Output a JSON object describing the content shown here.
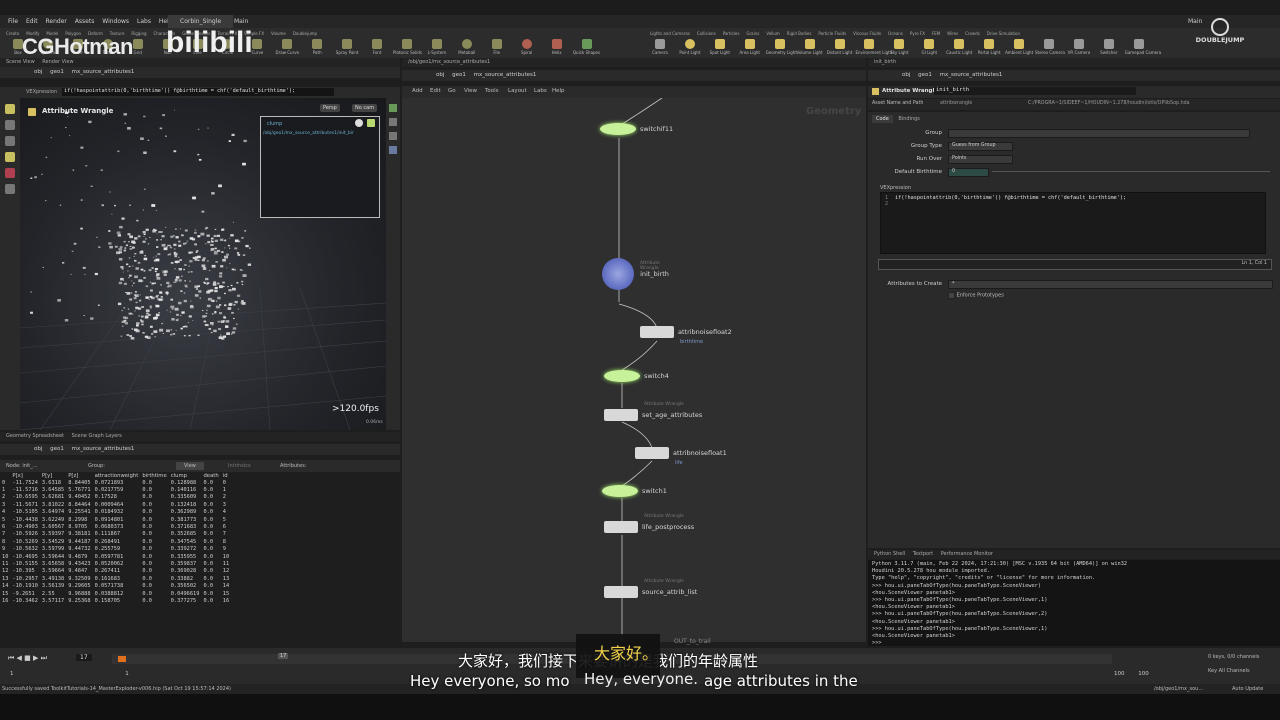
{
  "window": {
    "menu": [
      "File",
      "Edit",
      "Render",
      "Assets",
      "Windows",
      "Labs",
      "Help"
    ],
    "desktop": "Corbin_Single",
    "main_tab": "Main",
    "right_tab": "Main"
  },
  "watermark": {
    "left": "CGHotman",
    "right": "DOUBLEJUMP"
  },
  "shelf": {
    "tabs_left": [
      "Create",
      "Modify",
      "Model",
      "Polygon",
      "Deform",
      "Texture",
      "Rigging",
      "Characters",
      "Guide Process",
      "Terrain FX",
      "Simple FX",
      "Volume",
      "Doublejump"
    ],
    "tools_left": [
      "Box",
      "Sphere",
      "Tube",
      "Torus",
      "Grid",
      "Null",
      "Line",
      "Circle",
      "Curve",
      "Draw Curve",
      "Path",
      "Spray Paint",
      "Font",
      "Platonic Solids",
      "L-System",
      "Metaball",
      "File",
      "Spiral",
      "Helix",
      "Quick Shapes"
    ],
    "tabs_right": [
      "Lights and Cameras",
      "Collisions",
      "Particles",
      "Grains",
      "Vellum",
      "Rigid Bodies",
      "Particle Fluids",
      "Viscous Fluids",
      "Oceans",
      "Pyro FX",
      "FEM",
      "Wires",
      "Crowds",
      "Drive Simulation"
    ],
    "tools_right": [
      "Camera",
      "Point Light",
      "Spot Light",
      "Area Light",
      "Geometry Light",
      "Volume Light",
      "Distant Light",
      "Environment Light",
      "Sky Light",
      "GI Light",
      "Caustic Light",
      "Portal Light",
      "Ambient Light",
      "Stereo Camera",
      "VR Camera",
      "Switcher",
      "Gamepad Camera"
    ]
  },
  "viewer": {
    "tabs": [
      "Scene View",
      "Render View"
    ],
    "path": [
      "obj",
      "geo1",
      "mx_source_attributes1"
    ],
    "vex_label": "VEXpression",
    "vex_code": "if(!haspointattrib(0,'birthtime')) f@birthtime = chf('default_birthtime');",
    "persp": "Persp",
    "cam": "No cam",
    "title": "Attribute Wrangle",
    "fps": ">120.0fps",
    "ms": "0.06ms",
    "mini_label": "clump",
    "mini_path": "/obj/geo1/mx_source_attributes1/init_bir"
  },
  "spreadsheet": {
    "tabs": [
      "Geometry Spreadsheet",
      "Scene Graph Layers"
    ],
    "path": [
      "obj",
      "geo1",
      "mx_source_attributes1"
    ],
    "node_label": "Node: init_...",
    "group_label": "Group:",
    "view_label": "View",
    "intrinsics": "Intrinsics",
    "attributes_label": "Attributes:",
    "columns": [
      "",
      "P[x]",
      "P[y]",
      "P[z]",
      "attractionweight",
      "birthtime",
      "clump",
      "death",
      "id"
    ],
    "rows": [
      [
        "0",
        "-11.7524",
        "3.6318",
        "8.84405",
        "0.0721893",
        "0.0",
        "0.128988",
        "0.0",
        "0"
      ],
      [
        "1",
        "-11.5716",
        "3.64585",
        "5.76771",
        "0.0217759",
        "0.0",
        "0.140116",
        "0.0",
        "1"
      ],
      [
        "2",
        "-10.6595",
        "3.62681",
        "9.40452",
        "0.17528",
        "0.0",
        "0.335609",
        "0.0",
        "2"
      ],
      [
        "3",
        "-11.5671",
        "3.81022",
        "8.84464",
        "0.0009464",
        "0.0",
        "0.132418",
        "0.0",
        "3"
      ],
      [
        "4",
        "-10.5105",
        "3.64974",
        "9.25541",
        "0.0184932",
        "0.0",
        "0.362989",
        "0.0",
        "4"
      ],
      [
        "5",
        "-10.4438",
        "3.62249",
        "8.2998",
        "0.0914801",
        "0.0",
        "0.381773",
        "0.0",
        "5"
      ],
      [
        "6",
        "-10.4903",
        "3.60567",
        "8.9705",
        "0.0680373",
        "0.0",
        "0.371683",
        "0.0",
        "6"
      ],
      [
        "7",
        "-10.5926",
        "3.59397",
        "9.38181",
        "0.111867",
        "0.0",
        "0.352685",
        "0.0",
        "7"
      ],
      [
        "8",
        "-10.5269",
        "3.54529",
        "9.44187",
        "0.268491",
        "0.0",
        "0.347545",
        "0.0",
        "8"
      ],
      [
        "9",
        "-10.5632",
        "3.59799",
        "9.44732",
        "0.255759",
        "0.0",
        "0.339272",
        "0.0",
        "9"
      ],
      [
        "10",
        "-10.4695",
        "3.59644",
        "9.4879",
        "0.0597781",
        "0.0",
        "0.335955",
        "0.0",
        "10"
      ],
      [
        "11",
        "-10.5155",
        "3.65658",
        "9.43423",
        "0.0520062",
        "0.0",
        "0.359837",
        "0.0",
        "11"
      ],
      [
        "12",
        "-10.395",
        "3.59664",
        "9.4847",
        "0.267411",
        "0.0",
        "0.369028",
        "0.0",
        "12"
      ],
      [
        "13",
        "-10.2957",
        "3.49138",
        "9.32509",
        "0.161683",
        "0.0",
        "0.33882",
        "0.0",
        "13"
      ],
      [
        "14",
        "-10.1910",
        "3.56139",
        "9.29605",
        "0.0571738",
        "0.0",
        "0.356502",
        "0.0",
        "14"
      ],
      [
        "15",
        "-9.2651",
        "2.55",
        "9.96888",
        "0.0388812",
        "0.0",
        "0.0496619",
        "0.0",
        "15"
      ],
      [
        "16",
        "-10.3462",
        "3.57117",
        "9.25368",
        "0.158705",
        "0.0",
        "0.377275",
        "0.0",
        "16"
      ]
    ]
  },
  "network": {
    "path": [
      "obj",
      "geo1",
      "mx_source_attributes1"
    ],
    "menu": [
      "Add",
      "Edit",
      "Go",
      "View",
      "Tools",
      "Layout",
      "Labs",
      "Help"
    ],
    "context_label": "Geometry",
    "nodes": [
      {
        "name": "switchif11",
        "kind": "switch"
      },
      {
        "name": "init_birth",
        "kind": "wrangle",
        "sub": "Attribute Wrangle"
      },
      {
        "name": "attribnoisefloat2",
        "kind": "box",
        "tag": "birthtime"
      },
      {
        "name": "switch4",
        "kind": "switch"
      },
      {
        "name": "set_age_attributes",
        "kind": "box",
        "sub": "Attribute Wrangle"
      },
      {
        "name": "attribnoisefloat1",
        "kind": "box",
        "tag": "life"
      },
      {
        "name": "switch1",
        "kind": "switch"
      },
      {
        "name": "life_postprocess",
        "kind": "box",
        "sub": "Attribute Wrangle"
      },
      {
        "name": "source_attrib_list",
        "kind": "box",
        "sub": "Attribute Wrangle"
      }
    ],
    "out_label": "OUT_to_trail"
  },
  "params": {
    "tab": "init_birth",
    "path": [
      "obj",
      "geo1",
      "mx_source_attributes1"
    ],
    "title": "Attribute Wrangle",
    "node_name": "init_birth",
    "asset_label": "Asset Name and Path",
    "asset_name": "attribwrangle",
    "asset_path": "C:/PROGRA~1/SIDEEF~1/HOUDIN~1.278/houdini/otls/OPlibSop.hda",
    "tabs": [
      "Code",
      "Bindings"
    ],
    "group_label": "Group",
    "group_type_label": "Group Type",
    "group_type_value": "Guess from Group",
    "run_over_label": "Run Over",
    "run_over_value": "Points",
    "default_birthtime_label": "Default Birthtime",
    "default_birthtime_value": "0",
    "vex_label": "VEXpression",
    "code_line1": "if(!haspointattrib(0,'birthtime')) f@birthtime = chf('default_birthtime');",
    "line_numbers": [
      "1",
      "2"
    ],
    "cursor": "Ln 1, Col 1",
    "attributes_to_create_label": "Attributes to Create",
    "attributes_to_create_value": "*",
    "enforce_label": "Enforce Prototypes"
  },
  "python": {
    "tabs": [
      "Python Shell",
      "Textport",
      "Performance Monitor"
    ],
    "lines": [
      "Python 3.11.7 (main, Feb 22 2024, 17:21:30) [MSC v.1935 64 bit (AMD64)] on win32",
      "Houdini 20.5.278 hou module imported.",
      "Type \"help\", \"copyright\", \"credits\" or \"license\" for more information.",
      ">>> hou.ui.paneTabOfType(hou.paneTabType.SceneViewer)",
      "<hou.SceneViewer panetab1>",
      ">>> hou.ui.paneTabOfType(hou.paneTabType.SceneViewer,1)",
      "<hou.SceneViewer panetab1>",
      ">>> hou.ui.paneTabOfType(hou.paneTabType.SceneViewer,2)",
      "<hou.SceneViewer panetab1>",
      ">>> hou.ui.paneTabOfType(hou.paneTabType.SceneViewer,1)",
      "<hou.SceneViewer panetab1>",
      ">>>"
    ]
  },
  "timeline": {
    "frame": "17",
    "start": "1",
    "start2": "1",
    "end": "100",
    "end2": "100",
    "current_marker": "17",
    "keys_label": "0 keys, 0/0 channels",
    "key_all": "Key All Channels",
    "auto_update": "Auto Update",
    "status_path": "/obj/geo1/mx_sou...",
    "status": "Successfully saved ToolkitTutorials-14_MasterExploder-v006.hip (Sat Oct 19 15:57:14 2024)"
  },
  "subtitles": {
    "cn_top": "大家好，我们接下来要讲的是我们的年龄属性",
    "cn_overlay": "大家好。",
    "en": "Hey everyone, so mo",
    "en_overlay": "Hey, everyone.",
    "en_tail": "age attributes in the"
  }
}
